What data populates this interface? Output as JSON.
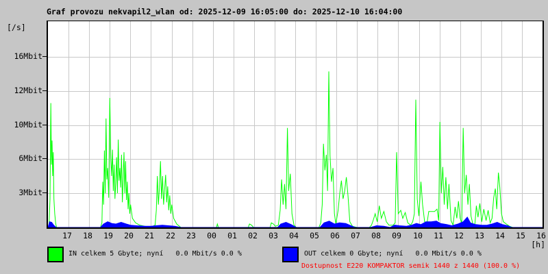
{
  "title": "Graf provozu nekvapil2_wlan od: 2025-12-09 16:05:00 do: 2025-12-10 16:04:00",
  "y_axis": {
    "unit_label": "[/s]",
    "ticks": [
      {
        "label": "16Mbit",
        "value": 16
      },
      {
        "label": "12Mbit",
        "value": 12
      },
      {
        "label": "10Mbit",
        "value": 10
      },
      {
        "label": "6Mbit",
        "value": 6
      },
      {
        "label": "3Mbit",
        "value": 3
      }
    ]
  },
  "x_axis": {
    "unit_label": "[h]",
    "ticks": [
      "17",
      "18",
      "19",
      "20",
      "21",
      "22",
      "23",
      "00",
      "01",
      "02",
      "03",
      "04",
      "05",
      "06",
      "07",
      "08",
      "09",
      "10",
      "11",
      "12",
      "13",
      "14",
      "15",
      "16"
    ]
  },
  "legend": {
    "in": {
      "label": "IN celkem 5 Gbyte; nyní   0.0 Mbit/s 0.0 %",
      "color": "#00ff00"
    },
    "out": {
      "label": "OUT celkem 0 Gbyte; nyní   0.0 Mbit/s 0.0 %",
      "color": "#0000ff"
    }
  },
  "availability": {
    "text": "Dostupnost E220 KOMPAKTOR semik 1440 z 1440 (100.0 %)",
    "color": "#ff0000"
  },
  "colors": {
    "background": "#c6c6c6",
    "plot_background": "#ffffff",
    "grid": "#c8c8c8",
    "axis": "#000000",
    "in_line": "#00ff00",
    "out_line": "#0000ff",
    "availability_text": "#ff0000"
  },
  "chart_data": {
    "type": "line",
    "title": "Graf provozu nekvapil2_wlan od: 2025-12-09 16:05:00 do: 2025-12-10 16:04:00",
    "xlabel": "[h]",
    "ylabel": "[/s]",
    "x_unit": "hours since 2025-12-09 16:05",
    "x_range": [
      0,
      24
    ],
    "x_tick_hours": [
      "17",
      "18",
      "19",
      "20",
      "21",
      "22",
      "23",
      "00",
      "01",
      "02",
      "03",
      "04",
      "05",
      "06",
      "07",
      "08",
      "09",
      "10",
      "11",
      "12",
      "13",
      "14",
      "15",
      "16"
    ],
    "y_ticks": [
      {
        "label": "16Mbit",
        "value": 16
      },
      {
        "label": "12Mbit",
        "value": 12
      },
      {
        "label": "10Mbit",
        "value": 10
      },
      {
        "label": "6Mbit",
        "value": 6
      },
      {
        "label": "3Mbit",
        "value": 3
      }
    ],
    "grid": true,
    "legend_position": "bottom",
    "series": [
      {
        "name": "IN",
        "color": "#00ff00",
        "unit": "Mbit/s",
        "fill": false,
        "points": [
          [
            0.0,
            0
          ],
          [
            0.05,
            0
          ],
          [
            0.1,
            2.5
          ],
          [
            0.14,
            11.3
          ],
          [
            0.17,
            5.5
          ],
          [
            0.2,
            8.2
          ],
          [
            0.23,
            4.5
          ],
          [
            0.26,
            6.8
          ],
          [
            0.29,
            2.5
          ],
          [
            0.33,
            1.2
          ],
          [
            0.38,
            0.3
          ],
          [
            0.42,
            0
          ],
          [
            1.0,
            0
          ],
          [
            2.0,
            0
          ],
          [
            2.55,
            0
          ],
          [
            2.62,
            0.4
          ],
          [
            2.66,
            4.0
          ],
          [
            2.7,
            2.0
          ],
          [
            2.74,
            7.0
          ],
          [
            2.78,
            3.0
          ],
          [
            2.82,
            10.4
          ],
          [
            2.86,
            4.2
          ],
          [
            2.9,
            5.2
          ],
          [
            2.95,
            2.6
          ],
          [
            3.0,
            11.6
          ],
          [
            3.05,
            6.0
          ],
          [
            3.09,
            4.5
          ],
          [
            3.13,
            7.1
          ],
          [
            3.17,
            3.2
          ],
          [
            3.21,
            5.5
          ],
          [
            3.25,
            2.5
          ],
          [
            3.29,
            4.0
          ],
          [
            3.33,
            6.2
          ],
          [
            3.37,
            3.0
          ],
          [
            3.41,
            8.3
          ],
          [
            3.45,
            4.1
          ],
          [
            3.49,
            5.2
          ],
          [
            3.53,
            3.5
          ],
          [
            3.57,
            6.5
          ],
          [
            3.61,
            2.2
          ],
          [
            3.65,
            4.2
          ],
          [
            3.69,
            6.8
          ],
          [
            3.73,
            3.0
          ],
          [
            3.77,
            5.8
          ],
          [
            3.81,
            2.4
          ],
          [
            3.85,
            4.0
          ],
          [
            3.89,
            1.6
          ],
          [
            3.93,
            3.0
          ],
          [
            3.97,
            1.2
          ],
          [
            4.01,
            2.0
          ],
          [
            4.1,
            0.8
          ],
          [
            4.25,
            0.4
          ],
          [
            4.45,
            0.2
          ],
          [
            4.7,
            0.1
          ],
          [
            4.95,
            0
          ],
          [
            5.2,
            0.2
          ],
          [
            5.26,
            1.5
          ],
          [
            5.31,
            4.5
          ],
          [
            5.36,
            2.0
          ],
          [
            5.41,
            3.5
          ],
          [
            5.46,
            5.8
          ],
          [
            5.51,
            2.5
          ],
          [
            5.56,
            4.5
          ],
          [
            5.61,
            2.0
          ],
          [
            5.66,
            3.3
          ],
          [
            5.71,
            4.6
          ],
          [
            5.76,
            2.2
          ],
          [
            5.81,
            3.6
          ],
          [
            5.86,
            1.5
          ],
          [
            5.91,
            2.8
          ],
          [
            5.96,
            1.2
          ],
          [
            6.01,
            2.0
          ],
          [
            6.1,
            0.8
          ],
          [
            6.25,
            0.3
          ],
          [
            6.45,
            0
          ],
          [
            8.18,
            0
          ],
          [
            8.22,
            0.3
          ],
          [
            8.27,
            0
          ],
          [
            9.72,
            0
          ],
          [
            9.78,
            0.3
          ],
          [
            9.88,
            0.2
          ],
          [
            9.98,
            0
          ],
          [
            10.78,
            0
          ],
          [
            10.84,
            0.4
          ],
          [
            10.94,
            0.3
          ],
          [
            11.04,
            0.1
          ],
          [
            11.18,
            0.2
          ],
          [
            11.27,
            1.5
          ],
          [
            11.34,
            4.2
          ],
          [
            11.41,
            2.0
          ],
          [
            11.48,
            3.8
          ],
          [
            11.55,
            1.6
          ],
          [
            11.62,
            9.7
          ],
          [
            11.68,
            3.2
          ],
          [
            11.76,
            4.7
          ],
          [
            11.84,
            1.2
          ],
          [
            11.94,
            0.2
          ],
          [
            12.05,
            0
          ],
          [
            12.5,
            0
          ],
          [
            13.15,
            0
          ],
          [
            13.24,
            0.4
          ],
          [
            13.31,
            2.0
          ],
          [
            13.37,
            7.8
          ],
          [
            13.44,
            5.0
          ],
          [
            13.51,
            6.5
          ],
          [
            13.57,
            3.2
          ],
          [
            13.63,
            14.3
          ],
          [
            13.69,
            6.4
          ],
          [
            13.76,
            4.0
          ],
          [
            13.83,
            5.2
          ],
          [
            13.9,
            1.2
          ],
          [
            13.97,
            0.3
          ],
          [
            14.08,
            1.5
          ],
          [
            14.16,
            3.0
          ],
          [
            14.24,
            4.1
          ],
          [
            14.32,
            2.5
          ],
          [
            14.4,
            3.2
          ],
          [
            14.48,
            4.4
          ],
          [
            14.56,
            2.8
          ],
          [
            14.65,
            0.5
          ],
          [
            14.78,
            0.1
          ],
          [
            15.0,
            0
          ],
          [
            15.6,
            0
          ],
          [
            15.7,
            0.2
          ],
          [
            15.78,
            0.6
          ],
          [
            15.88,
            1.2
          ],
          [
            15.98,
            0.5
          ],
          [
            16.08,
            1.9
          ],
          [
            16.18,
            0.8
          ],
          [
            16.3,
            1.4
          ],
          [
            16.42,
            0.5
          ],
          [
            16.55,
            0.2
          ],
          [
            16.75,
            0.2
          ],
          [
            16.85,
            0.4
          ],
          [
            16.92,
            6.8
          ],
          [
            17.0,
            1.2
          ],
          [
            17.12,
            1.5
          ],
          [
            17.22,
            0.8
          ],
          [
            17.34,
            1.3
          ],
          [
            17.46,
            0.4
          ],
          [
            17.6,
            0.2
          ],
          [
            17.7,
            0.5
          ],
          [
            17.78,
            1.2
          ],
          [
            17.85,
            11.5
          ],
          [
            17.92,
            2.5
          ],
          [
            18.0,
            1.0
          ],
          [
            18.1,
            4.0
          ],
          [
            18.18,
            2.0
          ],
          [
            18.28,
            0.5
          ],
          [
            18.4,
            0.4
          ],
          [
            18.48,
            1.4
          ],
          [
            18.62,
            1.4
          ],
          [
            18.76,
            1.4
          ],
          [
            18.88,
            1.6
          ],
          [
            18.96,
            0.6
          ],
          [
            19.02,
            10.2
          ],
          [
            19.09,
            3.0
          ],
          [
            19.16,
            5.3
          ],
          [
            19.23,
            2.0
          ],
          [
            19.31,
            4.4
          ],
          [
            19.39,
            1.6
          ],
          [
            19.46,
            3.8
          ],
          [
            19.56,
            0.6
          ],
          [
            19.66,
            0.2
          ],
          [
            19.76,
            1.8
          ],
          [
            19.84,
            0.8
          ],
          [
            19.92,
            2.3
          ],
          [
            20.0,
            0.8
          ],
          [
            20.08,
            0.4
          ],
          [
            20.15,
            9.7
          ],
          [
            20.22,
            3.0
          ],
          [
            20.3,
            4.6
          ],
          [
            20.38,
            2.0
          ],
          [
            20.45,
            3.8
          ],
          [
            20.53,
            1.0
          ],
          [
            20.62,
            0.3
          ],
          [
            20.72,
            0.3
          ],
          [
            20.79,
            1.9
          ],
          [
            20.87,
            0.9
          ],
          [
            20.96,
            2.1
          ],
          [
            21.05,
            0.5
          ],
          [
            21.15,
            1.6
          ],
          [
            21.26,
            0.6
          ],
          [
            21.36,
            1.5
          ],
          [
            21.46,
            0.4
          ],
          [
            21.55,
            0.8
          ],
          [
            21.63,
            2.6
          ],
          [
            21.71,
            3.4
          ],
          [
            21.78,
            1.6
          ],
          [
            21.86,
            4.8
          ],
          [
            21.93,
            3.5
          ],
          [
            22.01,
            1.2
          ],
          [
            22.1,
            0.5
          ],
          [
            22.24,
            0.3
          ],
          [
            22.4,
            0.1
          ],
          [
            22.55,
            0
          ],
          [
            24.0,
            0
          ]
        ]
      },
      {
        "name": "OUT",
        "color": "#0000ff",
        "unit": "Mbit/s",
        "fill": true,
        "points": [
          [
            0.0,
            0
          ],
          [
            0.08,
            0.5
          ],
          [
            0.18,
            0.45
          ],
          [
            0.28,
            0.2
          ],
          [
            0.4,
            0
          ],
          [
            2.55,
            0
          ],
          [
            2.7,
            0.3
          ],
          [
            2.9,
            0.5
          ],
          [
            3.1,
            0.35
          ],
          [
            3.3,
            0.3
          ],
          [
            3.55,
            0.45
          ],
          [
            3.8,
            0.3
          ],
          [
            4.0,
            0.2
          ],
          [
            4.3,
            0.15
          ],
          [
            4.7,
            0.1
          ],
          [
            5.0,
            0.1
          ],
          [
            5.25,
            0.15
          ],
          [
            5.55,
            0.2
          ],
          [
            5.85,
            0.15
          ],
          [
            6.15,
            0.1
          ],
          [
            6.45,
            0
          ],
          [
            8.2,
            0
          ],
          [
            11.15,
            0
          ],
          [
            11.3,
            0.3
          ],
          [
            11.55,
            0.45
          ],
          [
            11.8,
            0.25
          ],
          [
            12.05,
            0
          ],
          [
            13.2,
            0
          ],
          [
            13.4,
            0.4
          ],
          [
            13.65,
            0.55
          ],
          [
            13.9,
            0.3
          ],
          [
            14.15,
            0.4
          ],
          [
            14.45,
            0.35
          ],
          [
            14.7,
            0.15
          ],
          [
            14.9,
            0
          ],
          [
            15.65,
            0
          ],
          [
            15.95,
            0.15
          ],
          [
            16.3,
            0.1
          ],
          [
            16.6,
            0
          ],
          [
            16.82,
            0.2
          ],
          [
            17.05,
            0.15
          ],
          [
            17.4,
            0.1
          ],
          [
            17.65,
            0.2
          ],
          [
            17.88,
            0.35
          ],
          [
            18.1,
            0.25
          ],
          [
            18.35,
            0.5
          ],
          [
            18.6,
            0.5
          ],
          [
            18.85,
            0.55
          ],
          [
            19.05,
            0.35
          ],
          [
            19.35,
            0.25
          ],
          [
            19.6,
            0.15
          ],
          [
            19.9,
            0.3
          ],
          [
            20.15,
            0.5
          ],
          [
            20.35,
            0.9
          ],
          [
            20.5,
            0.4
          ],
          [
            20.75,
            0.25
          ],
          [
            21.05,
            0.2
          ],
          [
            21.3,
            0.2
          ],
          [
            21.55,
            0.3
          ],
          [
            21.8,
            0.45
          ],
          [
            22.05,
            0.25
          ],
          [
            22.3,
            0.15
          ],
          [
            22.5,
            0
          ],
          [
            24.0,
            0
          ]
        ]
      }
    ]
  }
}
